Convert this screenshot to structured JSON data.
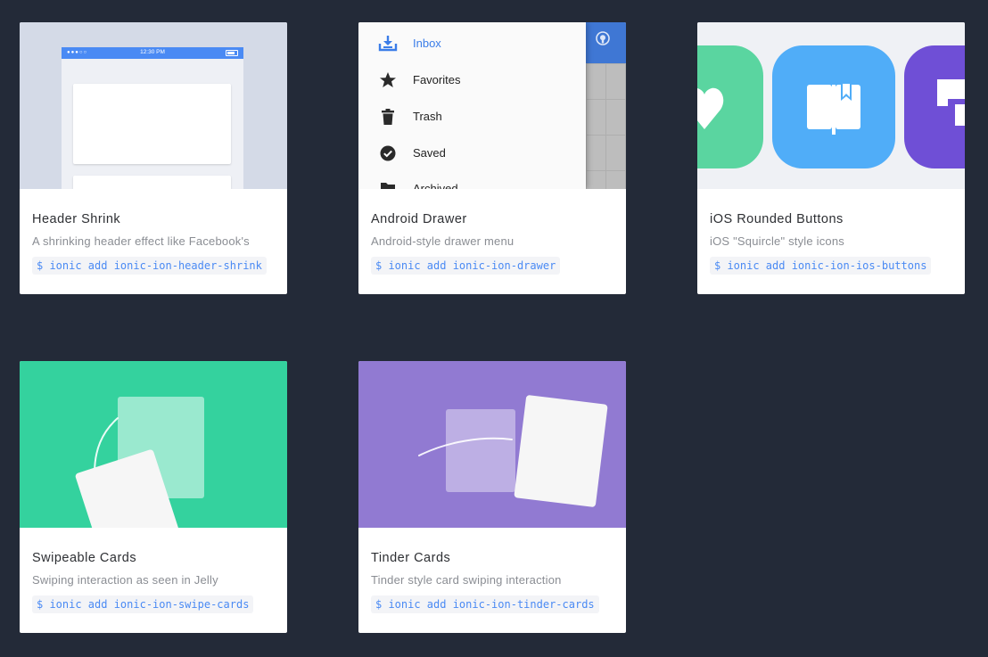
{
  "cards": [
    {
      "title": "Header Shrink",
      "description": "A shrinking header effect like Facebook's",
      "command": "$ ionic add ionic-ion-header-shrink",
      "preview": {
        "status_time": "12:30 PM",
        "status_dots": "●●●○○"
      }
    },
    {
      "title": "Android Drawer",
      "description": "Android-style drawer menu",
      "command": "$ ionic add ionic-ion-drawer",
      "preview": {
        "menu": [
          {
            "label": "Inbox",
            "icon": "inbox-icon",
            "active": true
          },
          {
            "label": "Favorites",
            "icon": "star-icon",
            "active": false
          },
          {
            "label": "Trash",
            "icon": "trash-icon",
            "active": false
          },
          {
            "label": "Saved",
            "icon": "check-circle-icon",
            "active": false
          },
          {
            "label": "Archived",
            "icon": "folder-icon",
            "active": false
          }
        ],
        "header_icon": "github-icon"
      }
    },
    {
      "title": "iOS Rounded Buttons",
      "description": "iOS \"Squircle\" style icons",
      "command": "$ ionic add ionic-ion-ios-buttons",
      "preview": {
        "colors": [
          "#5ad5a0",
          "#50adf8",
          "#6f4fd6"
        ]
      }
    },
    {
      "title": "Swipeable Cards",
      "description": "Swiping interaction as seen in Jelly",
      "command": "$ ionic add ionic-ion-swipe-cards"
    },
    {
      "title": "Tinder Cards",
      "description": "Tinder style card swiping interaction",
      "command": "$ ionic add ionic-ion-tinder-cards"
    }
  ],
  "colors": {
    "background": "#232a38",
    "command_text": "#4a8af4",
    "swipe_bg": "#34d29e",
    "tinder_bg": "#917ad2",
    "header_bar": "#4a8af4"
  }
}
